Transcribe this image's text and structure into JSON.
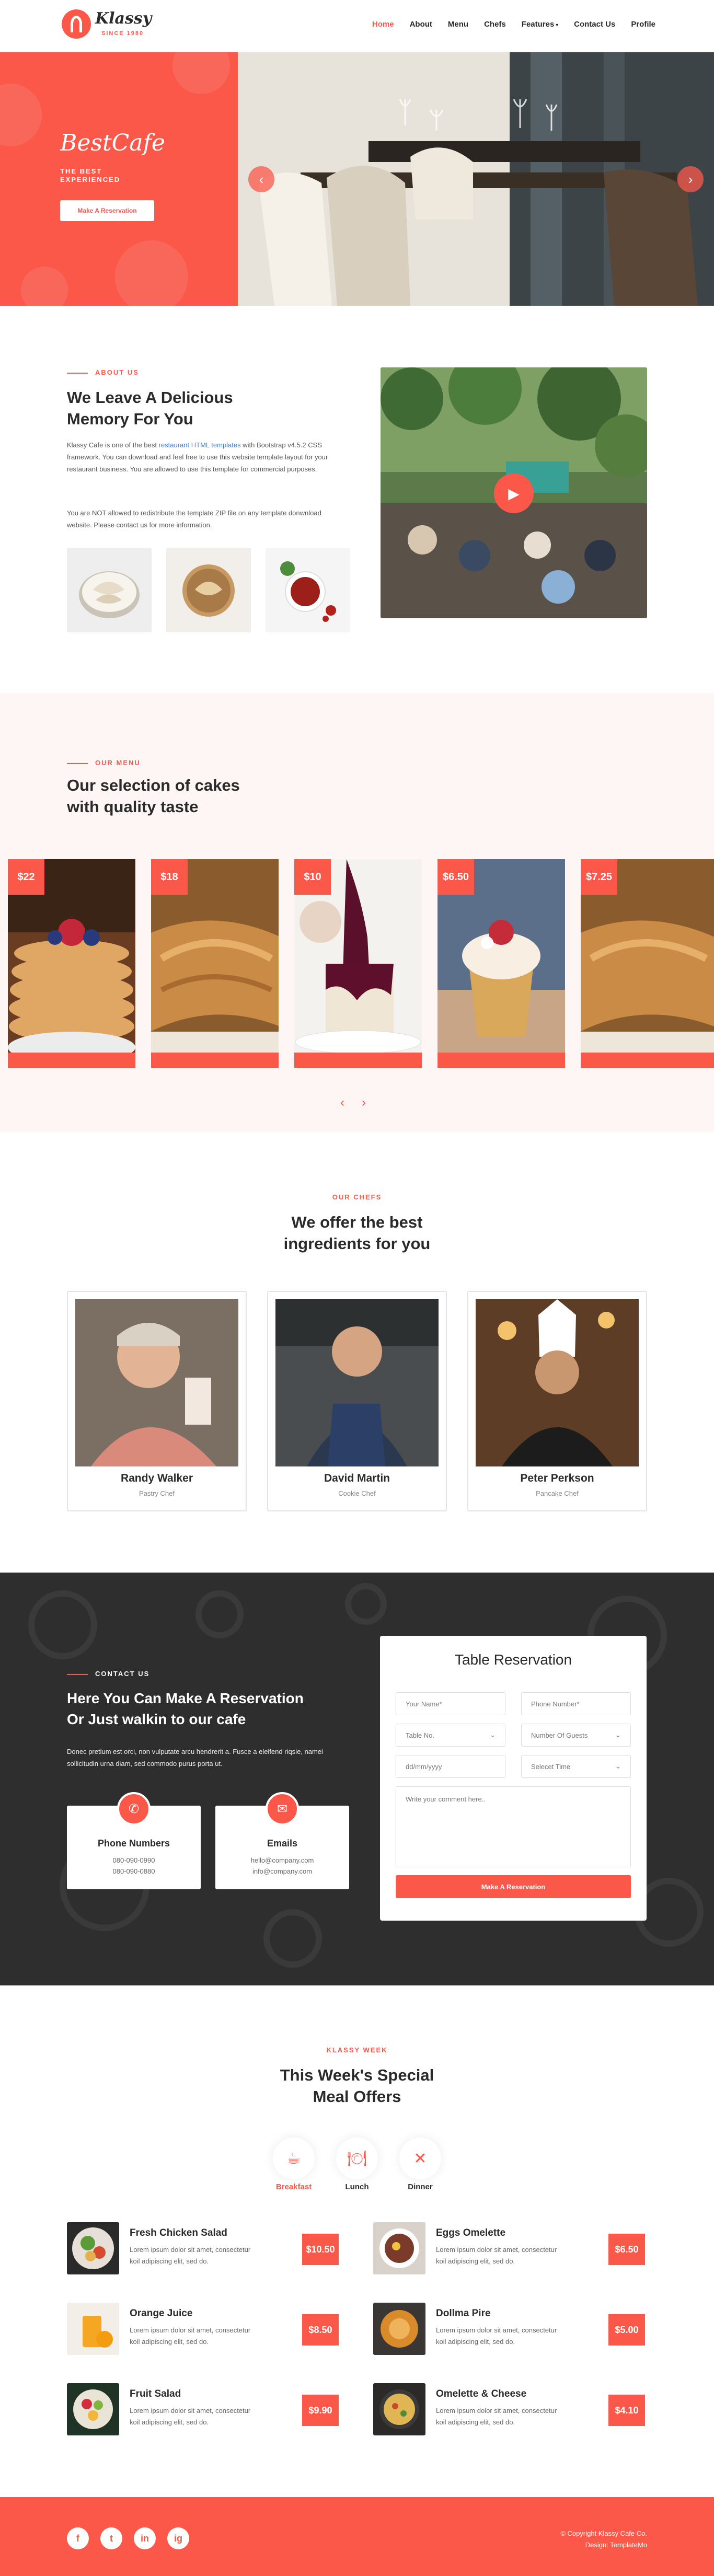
{
  "brand": {
    "name": "Klassy",
    "since": "SINCE 1980"
  },
  "nav": [
    {
      "label": "Home"
    },
    {
      "label": "About"
    },
    {
      "label": "Menu"
    },
    {
      "label": "Chefs"
    },
    {
      "label": "Features"
    },
    {
      "label": "Contact Us"
    },
    {
      "label": "Profile"
    }
  ],
  "hero": {
    "title": "BestCafe",
    "subtitle": "THE BEST EXPERIENCED",
    "button": "Make A Reservation"
  },
  "about": {
    "label": "About Us",
    "title_1": "We Leave A Delicious",
    "title_2": "Memory For You",
    "p1_a": "Klassy Cafe is one of the best ",
    "p1_link": "restaurant HTML templates",
    "p1_b": " with Bootstrap v4.5.2 CSS framework. You can download and feel free to use this website template layout for your restaurant business. You are allowed to use this template for commercial purposes.",
    "p2": "You are NOT allowed to redistribute the template ZIP file on any template donwnload website. Please contact us for more information."
  },
  "menu": {
    "label": "Our Menu",
    "title_1": "Our selection of cakes",
    "title_2": "with quality taste",
    "prices": [
      "$22",
      "$18",
      "$10",
      "$6.50",
      "$7.25"
    ]
  },
  "chefs": {
    "label": "Our Chefs",
    "title_1": "We offer the best",
    "title_2": "ingredients for you",
    "items": [
      {
        "name": "Randy Walker",
        "role": "Pastry Chef"
      },
      {
        "name": "David Martin",
        "role": "Cookie Chef"
      },
      {
        "name": "Peter Perkson",
        "role": "Pancake Chef"
      }
    ]
  },
  "contact": {
    "label": "Contact Us",
    "title_1": "Here You Can Make A Reservation",
    "title_2": "Or Just walkin to our cafe",
    "text": "Donec pretium est orci, non vulputate arcu hendrerit a. Fusce a eleifend riqsie, namei sollicitudin urna diam, sed commodo purus porta ut.",
    "phone": {
      "title": "Phone Numbers",
      "l1": "080-090-0990",
      "l2": "080-090-0880"
    },
    "email": {
      "title": "Emails",
      "l1": "hello@company.com",
      "l2": "info@company.com"
    }
  },
  "form": {
    "title": "Table Reservation",
    "name": "Your Name*",
    "phone": "Phone Number*",
    "table": "Table No.",
    "guests": "Number Of Guests",
    "date": "dd/mm/yyyy",
    "time": "Selecet Time",
    "comment": "Write your comment here..",
    "submit": "Make A Reservation"
  },
  "week": {
    "label": "Klassy Week",
    "title_1": "This Week's Special",
    "title_2": "Meal Offers",
    "tabs": [
      "Breakfast",
      "Lunch",
      "Dinner"
    ],
    "desc_1": "Lorem ipsum dolor sit amet, consectetur",
    "desc_2": "koil adipiscing elit, sed do.",
    "meals": [
      {
        "name": "Fresh Chicken Salad",
        "price": "$10.50"
      },
      {
        "name": "Eggs Omelette",
        "price": "$6.50"
      },
      {
        "name": "Orange Juice",
        "price": "$8.50"
      },
      {
        "name": "Dollma Pire",
        "price": "$5.00"
      },
      {
        "name": "Fruit Salad",
        "price": "$9.90"
      },
      {
        "name": "Omelette & Cheese",
        "price": "$4.10"
      }
    ]
  },
  "footer": {
    "copy": "© Copyright Klassy Cafe Co.",
    "design": "Design: TemplateMo",
    "social": [
      "f",
      "t",
      "in",
      "ig"
    ]
  },
  "colors": {
    "accent": "#fb5849",
    "dark": "#2e2e2e"
  }
}
